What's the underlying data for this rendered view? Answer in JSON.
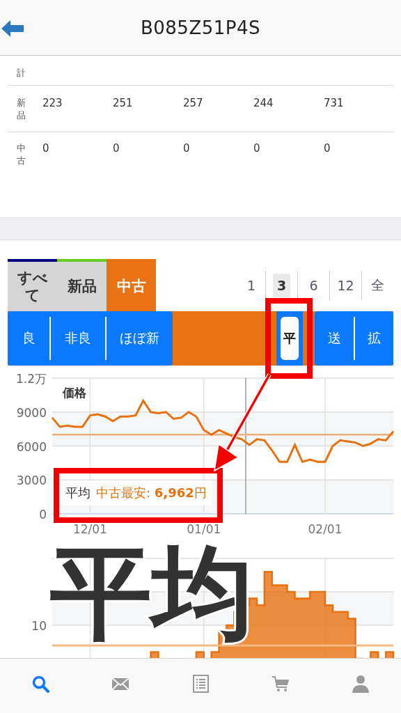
{
  "header": {
    "title": "B085Z51P4S"
  },
  "sales_table": {
    "rows": [
      {
        "label": "計"
      },
      {
        "label": "新品",
        "values": [
          "223",
          "251",
          "257",
          "244",
          "731"
        ]
      },
      {
        "label": "中古",
        "values": [
          "0",
          "0",
          "0",
          "0",
          "0"
        ]
      }
    ]
  },
  "condition_tabs": [
    {
      "label": "すべて",
      "color": "#000080",
      "selected": false
    },
    {
      "label": "新品",
      "color": "#66cc22",
      "selected": false
    },
    {
      "label": "中古",
      "color": "#e87212",
      "selected": true
    }
  ],
  "periods": [
    {
      "label": "1",
      "selected": false
    },
    {
      "label": "3",
      "selected": true
    },
    {
      "label": "6",
      "selected": false
    },
    {
      "label": "12",
      "selected": false
    },
    {
      "label": "全",
      "selected": false
    }
  ],
  "filter_buttons": [
    {
      "label": "良",
      "selected": false
    },
    {
      "label": "非良",
      "selected": false
    },
    {
      "label": "ほぼ新",
      "selected": false
    }
  ],
  "toggle_buttons": [
    {
      "label": "平",
      "selected": true
    },
    {
      "label": "送",
      "selected": false
    },
    {
      "label": "拡",
      "selected": false
    }
  ],
  "price_chart": {
    "title": "価格",
    "top_tick_label": "1.2万",
    "tooltip": {
      "value": ": **6,962**円"
    },
    "chart_data": {
      "type": "line",
      "ylim": [
        0,
        12000
      ],
      "categories": [
        null,
        null,
        null,
        null,
        null,
        "12/01",
        null,
        null,
        null,
        null,
        null,
        null,
        null,
        null,
        null,
        null,
        null,
        null,
        null,
        null,
        "01/01",
        null,
        null,
        null,
        null,
        null,
        null,
        null,
        null,
        null,
        null,
        null,
        null,
        null,
        null,
        null,
        "02/01",
        null,
        null,
        null,
        null,
        null,
        null,
        null,
        null,
        null
      ],
      "series": [
        {
          "name": "中古最安",
          "color": "#e8710f",
          "values": [
            8500,
            7700,
            7800,
            7700,
            7700,
            8700,
            8800,
            8600,
            8200,
            8600,
            8600,
            8700,
            10000,
            9000,
            8900,
            9000,
            8400,
            8500,
            9000,
            8600,
            7400,
            7000,
            7400,
            7100,
            6800,
            6600,
            6100,
            6600,
            6500,
            5600,
            4600,
            4600,
            6100,
            4600,
            4800,
            4600,
            4600,
            6000,
            6500,
            6400,
            6300,
            6000,
            6200,
            6600,
            6500,
            7300
          ]
        },
        {
          "name": "平均",
          "color": "#f0b07a",
          "values": [
            7000,
            7000,
            7000,
            7000,
            7000,
            7000,
            7000,
            7000,
            7000,
            7000,
            7000,
            7000,
            7000,
            7000,
            7000,
            7000,
            7000,
            7000,
            7000,
            7000,
            7000,
            7000,
            7000,
            7000,
            7000,
            7000,
            7000,
            7000,
            7000,
            7000,
            7000,
            7000,
            7000,
            7000,
            7000,
            7000,
            7000,
            7000,
            7000,
            7000,
            7000,
            7000,
            7000,
            7000,
            7000,
            7000
          ]
        }
      ],
      "yticks": [
        0,
        3000,
        6000,
        9000
      ],
      "grid": true
    }
  },
  "listing_chart": {
    "axis_label": "10"
  },
  "annotation": {
    "caption": "平均"
  },
  "bottom_nav": [
    {
      "kind": "search",
      "selected": true
    },
    {
      "kind": "mail",
      "selected": false
    },
    {
      "kind": "list",
      "selected": false
    },
    {
      "kind": "cart",
      "selected": false
    },
    {
      "kind": "person",
      "selected": false
    }
  ]
}
